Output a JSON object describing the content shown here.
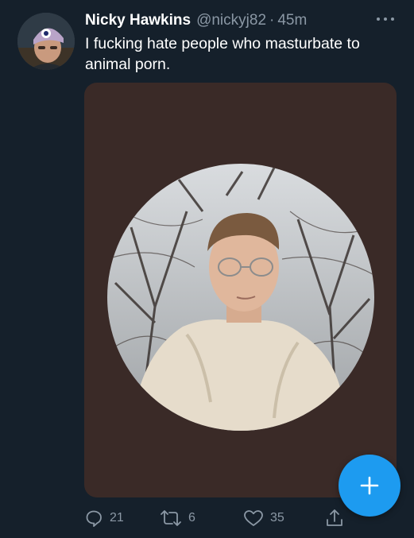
{
  "author": {
    "display_name": "Nicky Hawkins",
    "handle": "@nickyj82",
    "separator": "·",
    "timestamp": "45m"
  },
  "tweet": {
    "text": "I fucking hate people who masturbate to animal porn."
  },
  "actions": {
    "reply": {
      "icon": "reply-icon",
      "count": "21"
    },
    "retweet": {
      "icon": "retweet-icon",
      "count": "6"
    },
    "like": {
      "icon": "heart-icon",
      "count": "35"
    },
    "share": {
      "icon": "share-icon"
    }
  },
  "compose": {
    "icon": "plus-icon"
  },
  "colors": {
    "background": "#15202b",
    "text_primary": "#ffffff",
    "text_secondary": "#8b98a5",
    "accent": "#1d9bf0",
    "media_background": "#3a2a27"
  }
}
